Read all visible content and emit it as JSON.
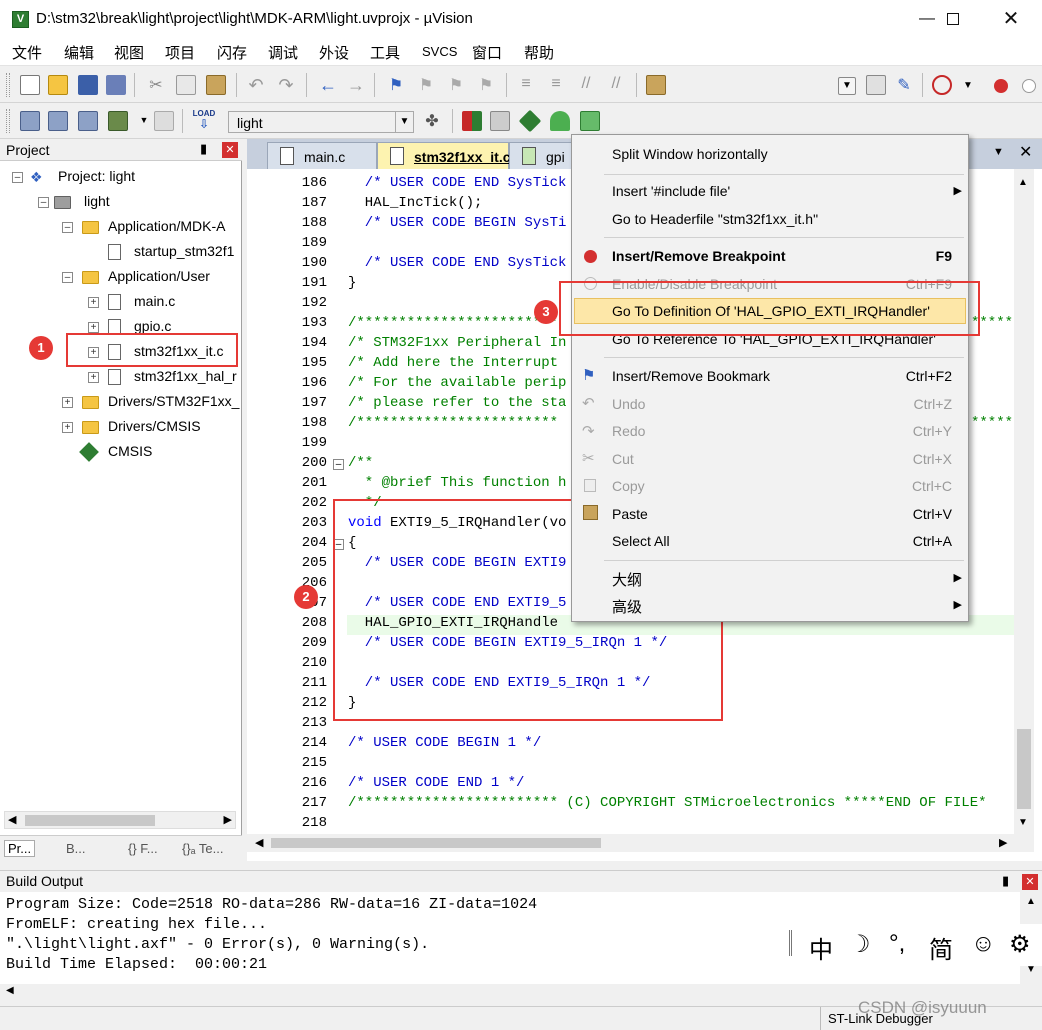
{
  "window": {
    "title": "D:\\stm32\\break\\light\\project\\light\\MDK-ARM\\light.uvprojx - µVision",
    "app_icon": "V"
  },
  "menu": [
    "文件",
    "编辑",
    "视图",
    "项目",
    "闪存",
    "调试",
    "外设",
    "工具",
    "SVCS",
    "窗口",
    "帮助"
  ],
  "toolbar2": {
    "target_select": "light",
    "load_label": "LOAD"
  },
  "project": {
    "header": "Project",
    "items": [
      "Project: light",
      "light",
      "Application/MDK-A",
      "startup_stm32f1",
      "Application/User",
      "main.c",
      "gpio.c",
      "stm32f1xx_it.c",
      "stm32f1xx_hal_r",
      "Drivers/STM32F1xx_",
      "Drivers/CMSIS",
      "CMSIS"
    ],
    "bottom_tabs": [
      "Pr...",
      "B...",
      "{} F...",
      "{}ₐ Te..."
    ]
  },
  "tabs": [
    "main.c",
    "stm32f1xx_it.c",
    "gpi"
  ],
  "line_numbers": [
    "186",
    "187",
    "188",
    "189",
    "190",
    "191",
    "192",
    "193",
    "194",
    "195",
    "196",
    "197",
    "198",
    "199",
    "200",
    "201",
    "202",
    "203",
    "204",
    "205",
    "206",
    "207",
    "208",
    "209",
    "210",
    "211",
    "212",
    "213",
    "214",
    "215",
    "216",
    "217",
    "218"
  ],
  "code": [
    "  /* USER CODE END SysTick",
    "  HAL_IncTick();",
    "  /* USER CODE BEGIN SysTi",
    "",
    "  /* USER CODE END SysTick",
    "}",
    "",
    "/************************",
    "/* STM32F1xx Peripheral In",
    "/* Add here the Interrupt ",
    "/* For the available perip",
    "/* please refer to the sta",
    "/************************",
    "",
    "/**",
    "  * @brief This function h",
    "  */",
    "void EXTI9_5_IRQHandler(vo",
    "{",
    "  /* USER CODE BEGIN EXTI9",
    "",
    "  /* USER CODE END EXTI9_5",
    "  HAL_GPIO_EXTI_IRQHandle",
    "  /* USER CODE BEGIN EXTI9_5_IRQn 1 */",
    "",
    "  /* USER CODE END EXTI9_5_IRQn 1 */",
    "}",
    "",
    "/* USER CODE BEGIN 1 */",
    "",
    "/* USER CODE END 1 */",
    "/************************ (C) COPYRIGHT STMicroelectronics *****END OF FILE*",
    ""
  ],
  "code_right_fragments": {
    "l193": "*****",
    "l198": "*****"
  },
  "context_menu": {
    "split": "Split Window horizontally",
    "insert_include": "Insert '#include file'",
    "goto_header": "Go to Headerfile \"stm32f1xx_it.h\"",
    "insert_bp": "Insert/Remove Breakpoint",
    "insert_bp_key": "F9",
    "enable_bp": "Enable/Disable Breakpoint",
    "enable_bp_key": "Ctrl+F9",
    "goto_def": "Go To Definition Of 'HAL_GPIO_EXTI_IRQHandler'",
    "goto_ref": "Go To Reference To 'HAL_GPIO_EXTI_IRQHandler'",
    "bookmark": "Insert/Remove Bookmark",
    "bookmark_key": "Ctrl+F2",
    "undo": "Undo",
    "undo_key": "Ctrl+Z",
    "redo": "Redo",
    "redo_key": "Ctrl+Y",
    "cut": "Cut",
    "cut_key": "Ctrl+X",
    "copy": "Copy",
    "copy_key": "Ctrl+C",
    "paste": "Paste",
    "paste_key": "Ctrl+V",
    "select_all": "Select All",
    "select_all_key": "Ctrl+A",
    "outline": "大纲",
    "advanced": "高级"
  },
  "annotations": {
    "one": "1",
    "two": "2",
    "three": "3"
  },
  "build": {
    "header": "Build Output",
    "lines": [
      "Program Size: Code=2518 RO-data=286 RW-data=16 ZI-data=1024",
      "FromELF: creating hex file...",
      "\".\\light\\light.axf\" - 0 Error(s), 0 Warning(s).",
      "Build Time Elapsed:  00:00:21"
    ]
  },
  "ime": {
    "lang": "中",
    "moon": "☽",
    "punct": "°,",
    "simp": "简"
  },
  "status": {
    "debugger": "ST-Link Debugger",
    "watermark": "CSDN @isyuuun"
  },
  "colors": {
    "highlight_box": "#e53935",
    "menu_highlight": "#fde7a8",
    "comment": "#0000c8"
  }
}
